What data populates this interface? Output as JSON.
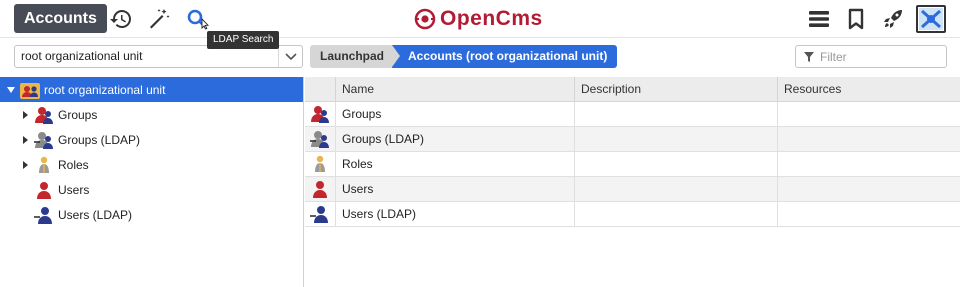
{
  "toolbar": {
    "app_title": "Accounts",
    "history_icon": "history-icon",
    "magic_icon": "magic-wand-icon",
    "search_icon": "search-icon",
    "tooltip": "LDAP Search",
    "logo_text_open": "Open",
    "logo_text_cms": "Cms",
    "menu_icon": "menu-icon",
    "bookmark_icon": "bookmark-icon",
    "rocket_icon": "rocket-icon",
    "user_icon": "user-avatar-icon"
  },
  "ou_select": {
    "value": "root organizational unit"
  },
  "breadcrumb": {
    "launchpad": "Launchpad",
    "current": "Accounts (root organizational unit)"
  },
  "filter": {
    "placeholder": "Filter"
  },
  "tree": {
    "root": "root organizational unit",
    "items": [
      {
        "label": "Groups",
        "icon": "group-icon",
        "expandable": true
      },
      {
        "label": "Groups (LDAP)",
        "icon": "ldap-group-icon",
        "expandable": true
      },
      {
        "label": "Roles",
        "icon": "role-icon",
        "expandable": true
      },
      {
        "label": "Users",
        "icon": "user-icon",
        "expandable": false
      },
      {
        "label": "Users (LDAP)",
        "icon": "ldap-user-icon",
        "expandable": false
      }
    ]
  },
  "table": {
    "headers": {
      "name": "Name",
      "description": "Description",
      "resources": "Resources"
    },
    "rows": [
      {
        "name": "Groups",
        "description": "",
        "resources": "",
        "icon": "group-icon"
      },
      {
        "name": "Groups (LDAP)",
        "description": "",
        "resources": "",
        "icon": "ldap-group-icon"
      },
      {
        "name": "Roles",
        "description": "",
        "resources": "",
        "icon": "role-icon"
      },
      {
        "name": "Users",
        "description": "",
        "resources": "",
        "icon": "user-icon"
      },
      {
        "name": "Users (LDAP)",
        "description": "",
        "resources": "",
        "icon": "ldap-user-icon"
      }
    ]
  },
  "colors": {
    "accent": "#2c6bdb",
    "brand": "#b31b34",
    "dark": "#474c57"
  }
}
